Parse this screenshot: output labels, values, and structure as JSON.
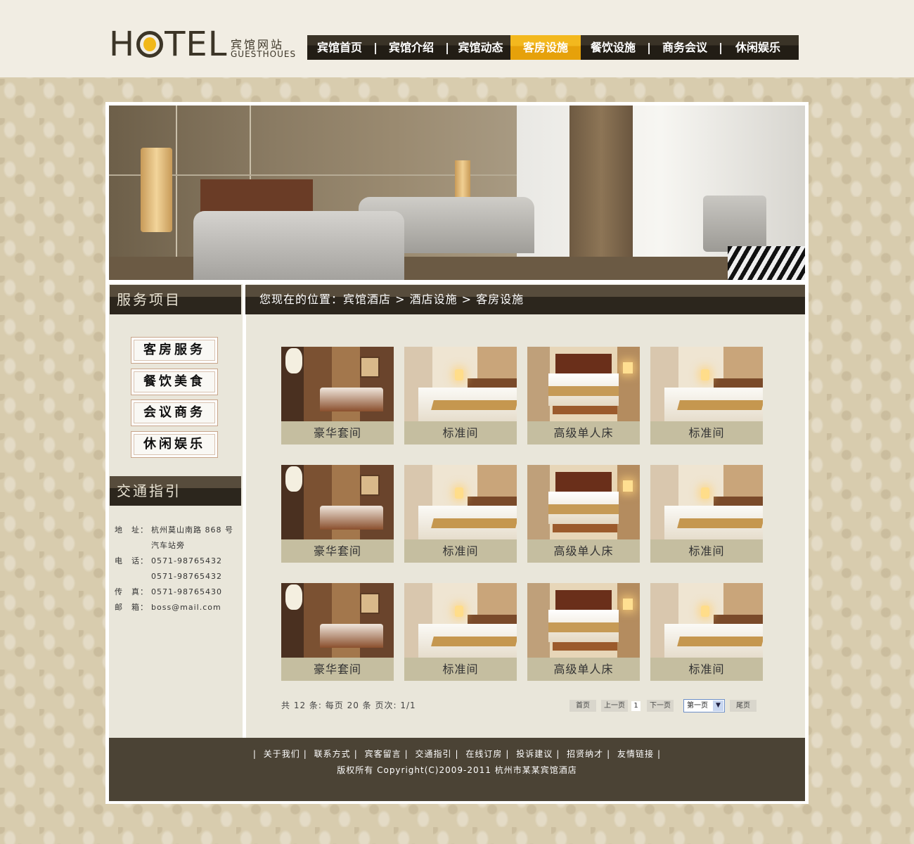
{
  "logo": {
    "word_left": "H",
    "word_right": "TEL",
    "cn": "宾馆网站",
    "en": "GUESTHOUES"
  },
  "nav": [
    {
      "label": "宾馆首页"
    },
    {
      "label": "宾馆介绍"
    },
    {
      "label": "宾馆动态"
    },
    {
      "label": "客房设施",
      "active": true
    },
    {
      "label": "餐饮设施"
    },
    {
      "label": "商务会议"
    },
    {
      "label": "休闲娱乐"
    }
  ],
  "nav_sep": "|",
  "sidebar": {
    "services_title": "服务项目",
    "services": [
      "客房服务",
      "餐饮美食",
      "会议商务",
      "休闲娱乐"
    ],
    "traffic_title": "交通指引",
    "contact": {
      "addr_label": "地　址：",
      "addr_line1": "杭州莫山南路 868 号",
      "addr_line2": "汽车站旁",
      "tel_label": "电　话：",
      "tel1": "0571-98765432",
      "tel2": "0571-98765432",
      "fax_label": "传　真：",
      "fax": "0571-98765430",
      "mail_label": "邮　箱：",
      "mail": "boss@mail.com"
    }
  },
  "breadcrumb": "您现在的位置：宾馆酒店 > 酒店设施 > 客房设施",
  "rooms": [
    [
      "豪华套间",
      "标准间",
      "高级单人床",
      "标准间"
    ],
    [
      "豪华套间",
      "标准间",
      "高级单人床",
      "标准间"
    ],
    [
      "豪华套间",
      "标准间",
      "高级单人床",
      "标准间"
    ]
  ],
  "pager": {
    "info": "共 12 条:  每页 20 条 页次:  1/1",
    "first": "首页",
    "prev": "上一页",
    "current": "1",
    "next": "下一页",
    "select": "第一页",
    "last": "尾页"
  },
  "footer": {
    "links": [
      "关于我们",
      "联系方式",
      "宾客留言",
      "交通指引",
      "在线订房",
      "投诉建议",
      "招贤纳才",
      "友情链接"
    ],
    "sep": "|",
    "copyright": "版权所有 Copyright(C)2009-2011 杭州市某某宾馆酒店"
  }
}
